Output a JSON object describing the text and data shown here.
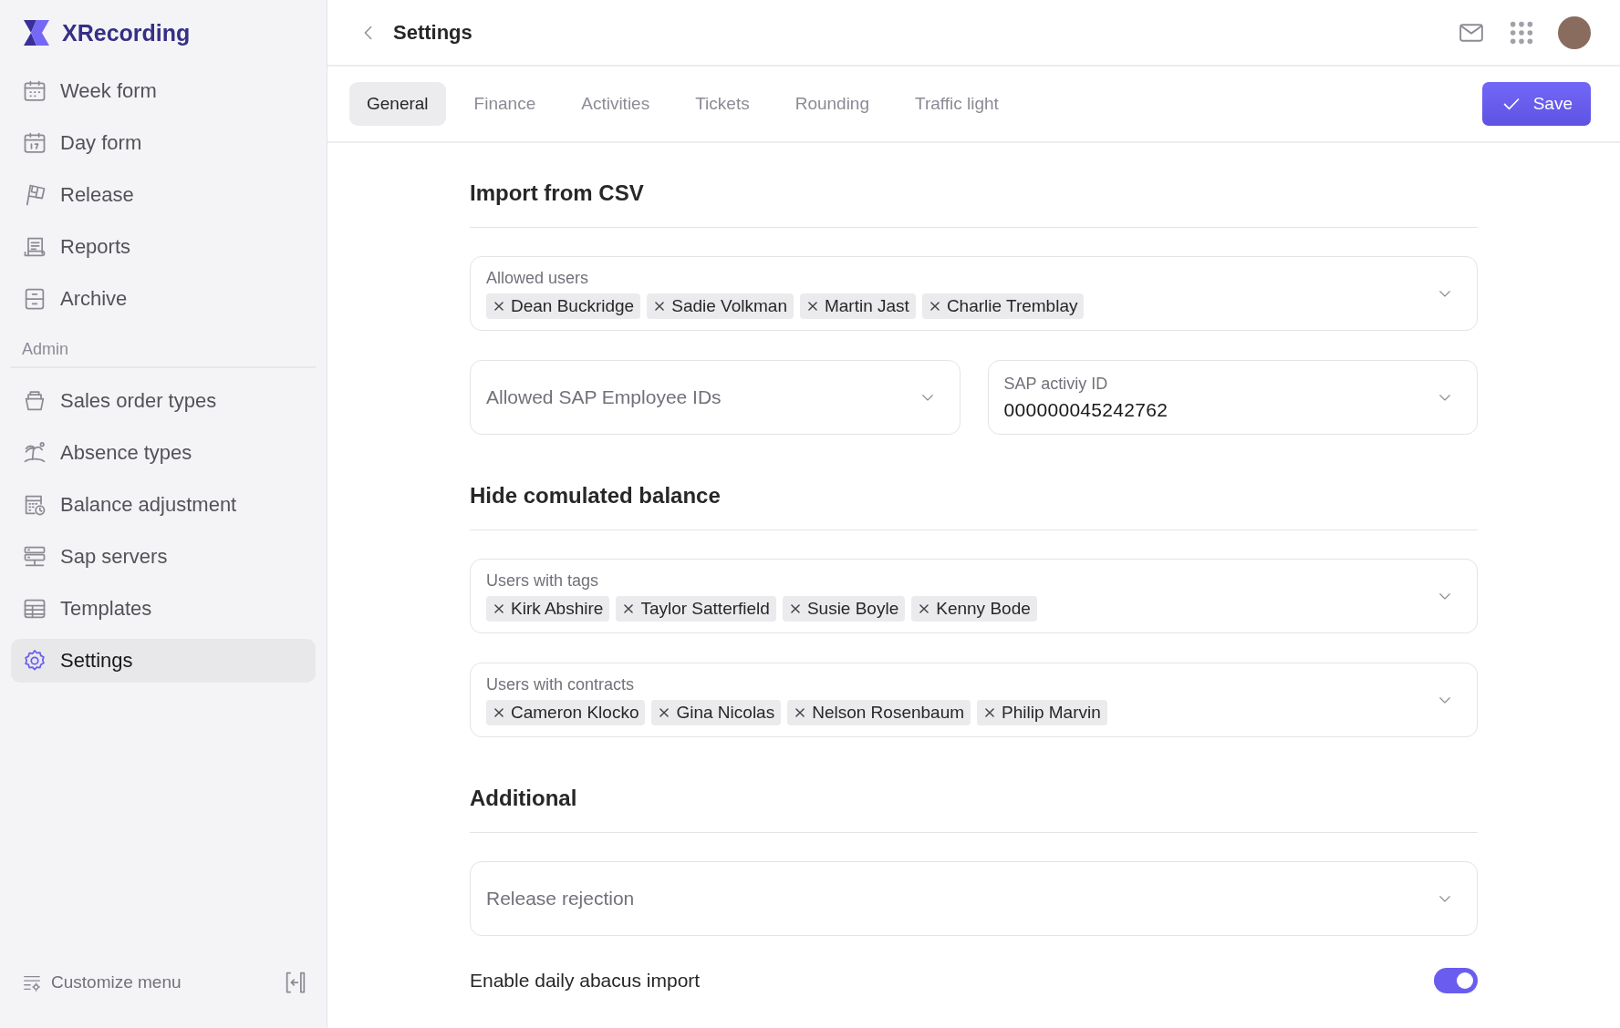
{
  "app": {
    "name": "XRecording"
  },
  "nav": [
    {
      "label": "Week form",
      "selected": false
    },
    {
      "label": "Day form",
      "selected": false
    },
    {
      "label": "Release",
      "selected": false
    },
    {
      "label": "Reports",
      "selected": false
    },
    {
      "label": "Archive",
      "selected": false
    }
  ],
  "admin": {
    "heading": "Admin",
    "items": [
      {
        "label": "Sales order types",
        "selected": false
      },
      {
        "label": "Absence types",
        "selected": false
      },
      {
        "label": "Balance adjustment",
        "selected": false
      },
      {
        "label": "Sap servers",
        "selected": false
      },
      {
        "label": "Templates",
        "selected": false
      },
      {
        "label": "Settings",
        "selected": true
      }
    ]
  },
  "customize_menu": "Customize menu",
  "header": {
    "title": "Settings"
  },
  "tabs": [
    {
      "label": "General",
      "selected": true
    },
    {
      "label": "Finance",
      "selected": false
    },
    {
      "label": "Activities",
      "selected": false
    },
    {
      "label": "Tickets",
      "selected": false
    },
    {
      "label": "Rounding",
      "selected": false
    },
    {
      "label": "Traffic light",
      "selected": false
    }
  ],
  "save_button": "Save",
  "sections": [
    {
      "title": "Import from CSV",
      "fields": [
        {
          "kind": "tags",
          "label": "Allowed users",
          "tags": [
            "Dean Buckridge",
            "Sadie Volkman",
            "Martin Jast",
            "Charlie Tremblay"
          ]
        },
        {
          "kind": "pair",
          "fields": [
            {
              "kind": "select",
              "placeholder": "Allowed SAP Employee IDs"
            },
            {
              "kind": "select",
              "label": "SAP activiy ID",
              "value": "000000045242762"
            }
          ]
        }
      ]
    },
    {
      "title": "Hide comulated balance",
      "fields": [
        {
          "kind": "tags",
          "label": "Users with tags",
          "tags": [
            "Kirk Abshire",
            "Taylor Satterfield",
            "Susie Boyle",
            "Kenny Bode"
          ]
        },
        {
          "kind": "tags",
          "label": "Users with contracts",
          "tags": [
            "Cameron Klocko",
            "Gina Nicolas",
            "Nelson Rosenbaum",
            "Philip Marvin"
          ]
        }
      ]
    },
    {
      "title": "Additional",
      "fields": [
        {
          "kind": "select",
          "placeholder": "Release rejection"
        },
        {
          "kind": "toggle",
          "label": "Enable daily abacus import",
          "on": true
        }
      ]
    }
  ]
}
